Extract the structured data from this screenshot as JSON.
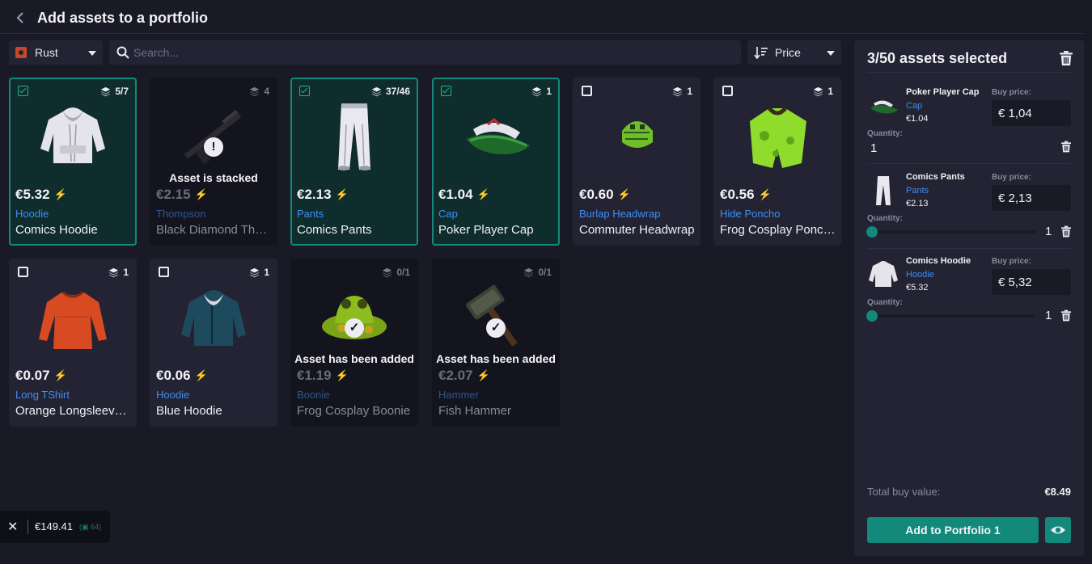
{
  "header": {
    "title": "Add assets to a portfolio"
  },
  "toolbar": {
    "game": "Rust",
    "search_placeholder": "Search...",
    "sort": "Price"
  },
  "cards": [
    {
      "stack": "5/7",
      "price": "€5.32",
      "category": "Hoodie",
      "name": "Comics Hoodie"
    },
    {
      "stack": "4",
      "price": "€2.15",
      "category": "Thompson",
      "name": "Black Diamond Thompson",
      "badge": "!",
      "note": "Asset is stacked"
    },
    {
      "stack": "37/46",
      "price": "€2.13",
      "category": "Pants",
      "name": "Comics Pants"
    },
    {
      "stack": "1",
      "price": "€1.04",
      "category": "Cap",
      "name": "Poker Player Cap"
    },
    {
      "stack": "1",
      "price": "€0.60",
      "category": "Burlap Headwrap",
      "name": "Commuter Headwrap"
    },
    {
      "stack": "1",
      "price": "€0.56",
      "category": "Hide Poncho",
      "name": "Frog Cosplay Poncho"
    },
    {
      "stack": "1",
      "price": "€0.07",
      "category": "Long TShirt",
      "name": "Orange Longsleeve T-Shirt"
    },
    {
      "stack": "1",
      "price": "€0.06",
      "category": "Hoodie",
      "name": "Blue Hoodie"
    },
    {
      "stack": "0/1",
      "price": "€1.19",
      "category": "Boonie",
      "name": "Frog Cosplay Boonie",
      "badge": "✓",
      "note": "Asset has been added"
    },
    {
      "stack": "0/1",
      "price": "€2.07",
      "category": "Hammer",
      "name": "Fish Hammer",
      "badge": "✓",
      "note": "Asset has been added"
    }
  ],
  "panel": {
    "title": "3/50 assets selected",
    "buy_price_label": "Buy price:",
    "quantity_label": "Quantity:",
    "items": [
      {
        "name": "Poker Player Cap",
        "category": "Cap",
        "price": "€1.04",
        "buy_price": "€ 1,04",
        "quantity": "1"
      },
      {
        "name": "Comics Pants",
        "category": "Pants",
        "price": "€2.13",
        "buy_price": "€ 2,13",
        "quantity": "1"
      },
      {
        "name": "Comics Hoodie",
        "category": "Hoodie",
        "price": "€5.32",
        "buy_price": "€ 5,32",
        "quantity": "1"
      }
    ],
    "total_label": "Total buy value:",
    "total_value": "€8.49",
    "add_button": "Add to Portfolio 1"
  },
  "wallet": {
    "close": "✕",
    "amount": "€149.41",
    "count": "64"
  },
  "colors": {
    "accent": "#12897a",
    "link": "#3d8ff5",
    "bolt": "#1fb57d",
    "background": "#1a1a26",
    "surface": "#232333"
  }
}
